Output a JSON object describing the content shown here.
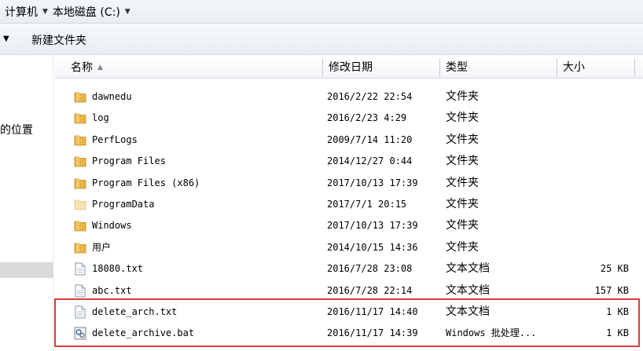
{
  "address_bar": {
    "crumbs": [
      "计算机",
      "本地磁盘 (C:)"
    ]
  },
  "toolbar": {
    "new_folder_label": "新建文件夹"
  },
  "nav_pane": {
    "locations_label": "的位置"
  },
  "columns": {
    "name": "名称",
    "date": "修改日期",
    "type": "类型",
    "size": "大小"
  },
  "files": [
    {
      "name": "dawnedu",
      "date": "2016/2/22 22:54",
      "type": "文件夹",
      "size": "",
      "icon": "folder-icon"
    },
    {
      "name": "log",
      "date": "2016/2/23 4:29",
      "type": "文件夹",
      "size": "",
      "icon": "folder-icon"
    },
    {
      "name": "PerfLogs",
      "date": "2009/7/14 11:20",
      "type": "文件夹",
      "size": "",
      "icon": "folder-icon"
    },
    {
      "name": "Program Files",
      "date": "2014/12/27 0:44",
      "type": "文件夹",
      "size": "",
      "icon": "folder-icon"
    },
    {
      "name": "Program Files (x86)",
      "date": "2017/10/13 17:39",
      "type": "文件夹",
      "size": "",
      "icon": "folder-icon"
    },
    {
      "name": "ProgramData",
      "date": "2017/7/1 20:15",
      "type": "文件夹",
      "size": "",
      "icon": "folder-light-icon"
    },
    {
      "name": "Windows",
      "date": "2017/10/13 17:39",
      "type": "文件夹",
      "size": "",
      "icon": "folder-icon"
    },
    {
      "name": "用户",
      "date": "2014/10/15 14:36",
      "type": "文件夹",
      "size": "",
      "icon": "folder-icon"
    },
    {
      "name": "18080.txt",
      "date": "2016/7/28 23:08",
      "type": "文本文档",
      "size": "25 KB",
      "icon": "text-file-icon"
    },
    {
      "name": "abc.txt",
      "date": "2016/7/28 22:14",
      "type": "文本文档",
      "size": "157 KB",
      "icon": "text-file-icon"
    },
    {
      "name": "delete_arch.txt",
      "date": "2016/11/17 14:40",
      "type": "文本文档",
      "size": "1 KB",
      "icon": "text-file-icon"
    },
    {
      "name": "delete_archive.bat",
      "date": "2016/11/17 14:39",
      "type": "Windows 批处理...",
      "size": "1 KB",
      "icon": "batch-file-icon"
    }
  ],
  "colors": {
    "highlight": "#e0393e",
    "folder": "#e9b548"
  }
}
